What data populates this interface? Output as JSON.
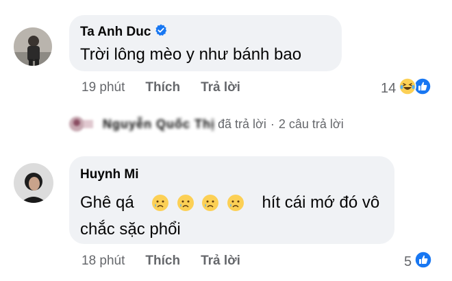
{
  "comments": [
    {
      "author": "Ta Anh Duc",
      "verified": true,
      "text": "Trời lông mèo y như bánh bao",
      "time": "19 phút",
      "like_label": "Thích",
      "reply_label": "Trả lời",
      "reaction_count": "14",
      "reactions": [
        "haha-icon",
        "like-icon"
      ]
    },
    {
      "author": "Huynh Mi",
      "verified": false,
      "text_line1_start": "Ghê qá",
      "text_line1_end": "hít cái mớ đó vô",
      "text_line2": "chắc sặc phổi",
      "emojis": [
        "crying-face-icon",
        "crying-face-icon",
        "crying-face-icon",
        "crying-face-icon"
      ],
      "time": "18 phút",
      "like_label": "Thích",
      "reply_label": "Trả lời",
      "reaction_count": "5",
      "reactions": [
        "like-icon"
      ]
    }
  ],
  "reply_summary": {
    "name": "Nguyễn Quốc Thị",
    "action": "đã trả lời",
    "separator": "·",
    "count_text": "2 câu trả lời"
  },
  "colors": {
    "bubble": "#f0f2f5",
    "text": "#050505",
    "meta": "#65676b",
    "like_blue": "#1877f2"
  }
}
